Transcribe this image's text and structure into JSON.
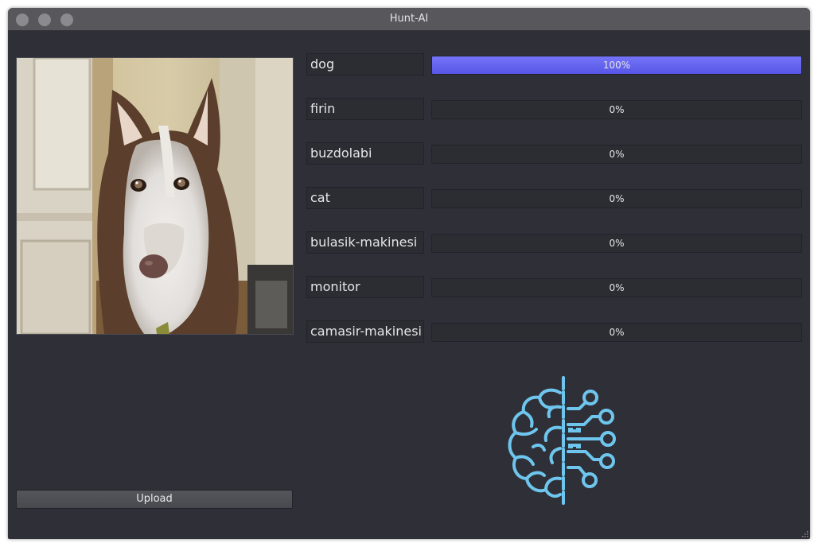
{
  "window": {
    "title": "Hunt-AI"
  },
  "image": {
    "subject": "husky dog photo"
  },
  "upload": {
    "label": "Upload"
  },
  "predictions": [
    {
      "label": "dog",
      "percent": 100,
      "text": "100%"
    },
    {
      "label": "firin",
      "percent": 0,
      "text": "0%"
    },
    {
      "label": "buzdolabi",
      "percent": 0,
      "text": "0%"
    },
    {
      "label": "cat",
      "percent": 0,
      "text": "0%"
    },
    {
      "label": "bulasik-makinesi",
      "percent": 0,
      "text": "0%"
    },
    {
      "label": "monitor",
      "percent": 0,
      "text": "0%"
    },
    {
      "label": "camasir-makinesi",
      "percent": 0,
      "text": "0%"
    }
  ],
  "colors": {
    "background": "#2f3037",
    "titlebar": "#58585c",
    "progress_fill": "#6665f0",
    "logo": "#6ec6ee"
  },
  "icons": {
    "logo": "brain-circuit-icon"
  }
}
